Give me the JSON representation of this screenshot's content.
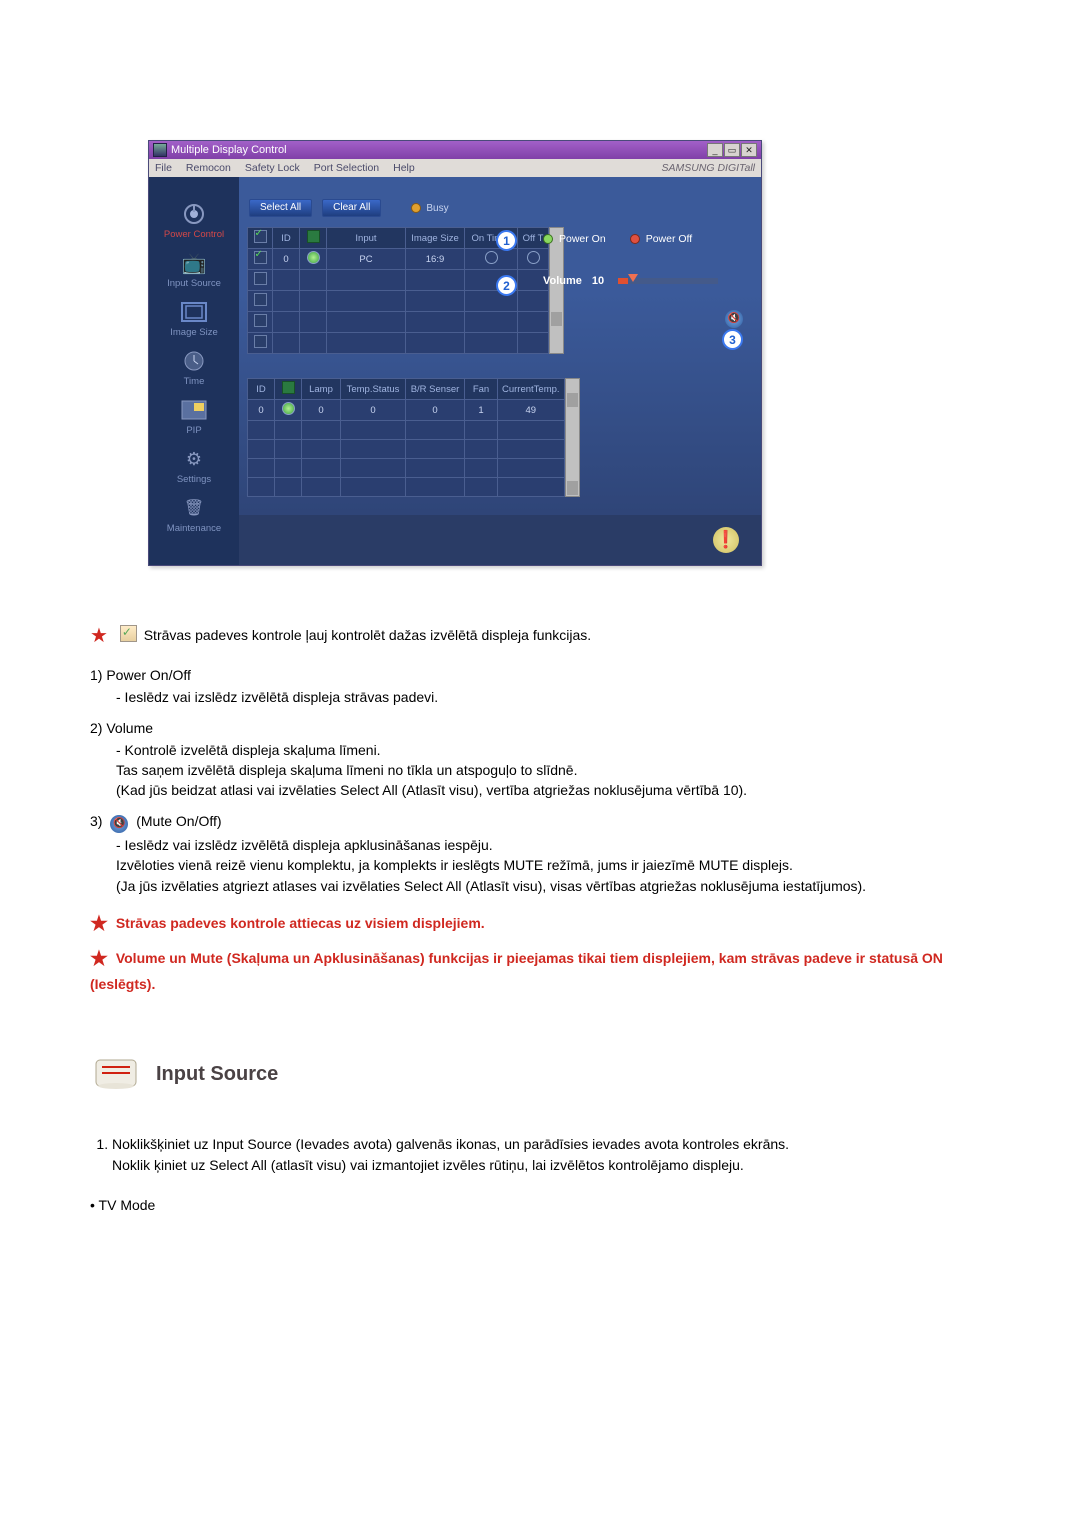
{
  "window": {
    "title": "Multiple Display Control",
    "menus": [
      "File",
      "Remocon",
      "Safety Lock",
      "Port Selection",
      "Help"
    ],
    "brand": "SAMSUNG DIGITall"
  },
  "sidebar": [
    {
      "label": "Power Control",
      "icon": "power"
    },
    {
      "label": "Input Source",
      "icon": "input"
    },
    {
      "label": "Image Size",
      "icon": "imagesize"
    },
    {
      "label": "Time",
      "icon": "time"
    },
    {
      "label": "PIP",
      "icon": "pip"
    },
    {
      "label": "Settings",
      "icon": "settings"
    },
    {
      "label": "Maintenance",
      "icon": "maintenance"
    }
  ],
  "toolbar": {
    "select_all": "Select All",
    "clear_all": "Clear All",
    "busy": "Busy"
  },
  "table1": {
    "headers": [
      "ID",
      "Input",
      "Image Size",
      "On Timer",
      "Off T"
    ],
    "rows": [
      {
        "checked": true,
        "id": "0",
        "indicator": "green",
        "input": "PC",
        "imagesize": "16:9",
        "ontimer": "○",
        "offtimer": "○"
      },
      {
        "checked": false
      },
      {
        "checked": false
      },
      {
        "checked": false
      },
      {
        "checked": false
      }
    ]
  },
  "table2": {
    "headers": [
      "ID",
      "Lamp",
      "Temp.Status",
      "B/R Senser",
      "Fan",
      "CurrentTemp."
    ],
    "rows": [
      {
        "id": "0",
        "indicator": "green",
        "lamp": "0",
        "tempstatus": "0",
        "brsenser": "0",
        "fan": "1",
        "currenttemp": "49"
      },
      {},
      {},
      {},
      {}
    ]
  },
  "controls": {
    "power_on": "Power On",
    "power_off": "Power Off",
    "volume_label": "Volume",
    "volume_value": "10"
  },
  "callouts": [
    "1",
    "2",
    "3"
  ],
  "doc": {
    "intro": "Strāvas padeves kontrole ļauj kontrolēt dažas izvēlētā displeja funkcijas.",
    "p1_title": "1)  Power On/Off",
    "p1_body": "- Ieslēdz vai izslēdz izvēlētā displeja strāvas padevi.",
    "p2_title": "2)  Volume",
    "p2_l1": "- Kontrolē izvelētā displeja skaļuma līmeni.",
    "p2_l2": "Tas saņem izvēlētā displeja skaļuma līmeni no tīkla un atspoguļo to slīdnē.",
    "p2_l3": "(Kad jūs beidzat atlasi vai izvēlaties Select All (Atlasīt visu), vertība atgriežas noklusējuma vērtībā 10).",
    "p3_prefix": "3)",
    "p3_label": "(Mute On/Off)",
    "p3_l1": "- Ieslēdz vai izslēdz izvēlētā displeja apklusināšanas iespēju.",
    "p3_l2": "Izvēloties vienā reizē vienu komplektu, ja komplekts ir ieslēgts MUTE režīmā, jums ir jaiezīmē MUTE displejs.",
    "p3_l3": "(Ja jūs izvēlaties atgriezt atlases vai izvēlaties Select All (Atlasīt visu), visas vērtības atgriežas noklusējuma iestatījumos).",
    "star1": "Strāvas padeves kontrole attiecas uz visiem displejiem.",
    "star2": "Volume un Mute (Skaļuma un Apklusināšanas) funkcijas ir pieejamas tikai tiem displejiem, kam strāvas padeve ir statusā ON (Ieslēgts).",
    "section_title": "Input Source",
    "instr1": "Noklikšķiniet uz Input Source (Ievades avota) galvenās ikonas, un parādīsies ievades avota kontroles ekrāns.",
    "instr1b": "Noklik   ķiniet uz Select All (atlasīt visu) vai izmantojiet izvēles rūtiņu, lai izvēlētos kontrolējamo displeju.",
    "tv_mode": "• TV Mode"
  }
}
